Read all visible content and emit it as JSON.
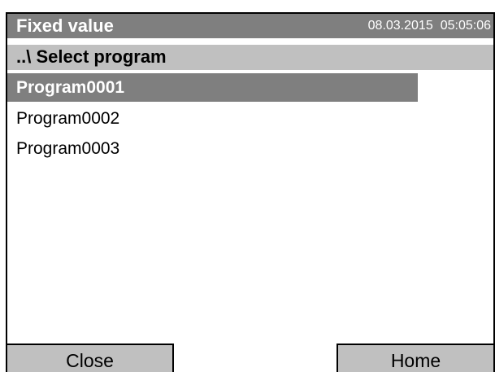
{
  "header": {
    "title": "Fixed value",
    "date": "08.03.2015",
    "time": "05:05:06"
  },
  "path": {
    "label": "..\\ Select program"
  },
  "programs": [
    {
      "label": "Program0001",
      "selected": true
    },
    {
      "label": "Program0002",
      "selected": false
    },
    {
      "label": "Program0003",
      "selected": false
    }
  ],
  "buttons": {
    "close_label": "Close",
    "home_label": "Home"
  },
  "colors": {
    "header_bg": "#7f7f7f",
    "path_bg": "#c0c0c0",
    "selection_bg": "#7f7f7f",
    "button_bg": "#c0c0c0"
  }
}
